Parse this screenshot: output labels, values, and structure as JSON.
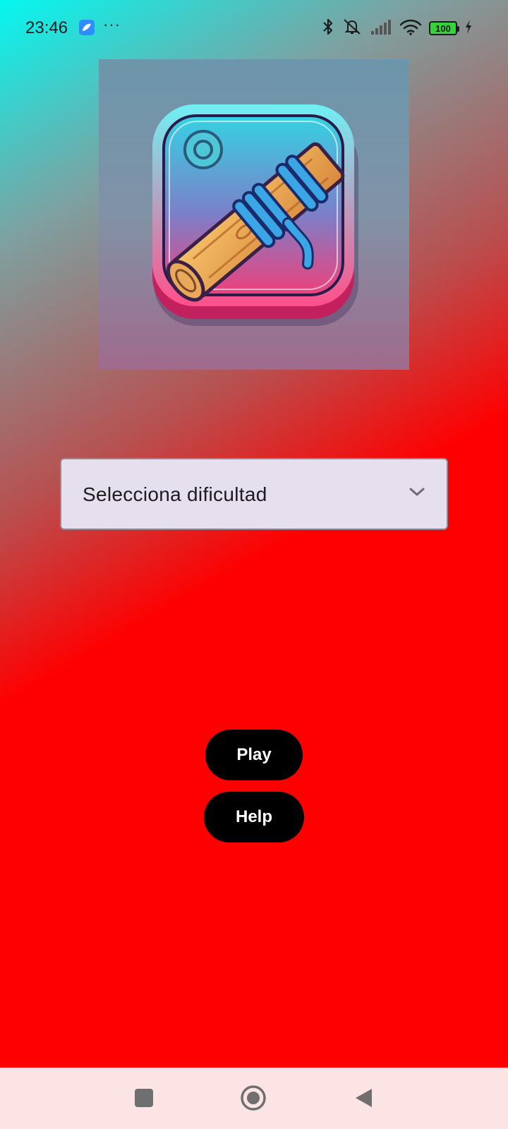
{
  "status_bar": {
    "time": "23:46",
    "more": "···",
    "battery_level": "100",
    "icons": [
      "app-notification-icon",
      "bluetooth-icon",
      "mute-icon",
      "signal-icon",
      "wifi-icon",
      "battery-icon",
      "charging-icon"
    ]
  },
  "logo": {
    "icon": "log-rope-knot-icon"
  },
  "difficulty": {
    "placeholder": "Selecciona dificultad"
  },
  "buttons": {
    "play": "Play",
    "help": "Help"
  },
  "nav_bar": {
    "icons": [
      "recents-icon",
      "home-icon",
      "back-icon"
    ]
  },
  "colors": {
    "gradient_start": "#05f7f0",
    "gradient_end": "#ff0000",
    "dropdown_bg": "#e6dfee",
    "button_bg": "#000000",
    "nav_bar_bg": "#fde4e4"
  }
}
